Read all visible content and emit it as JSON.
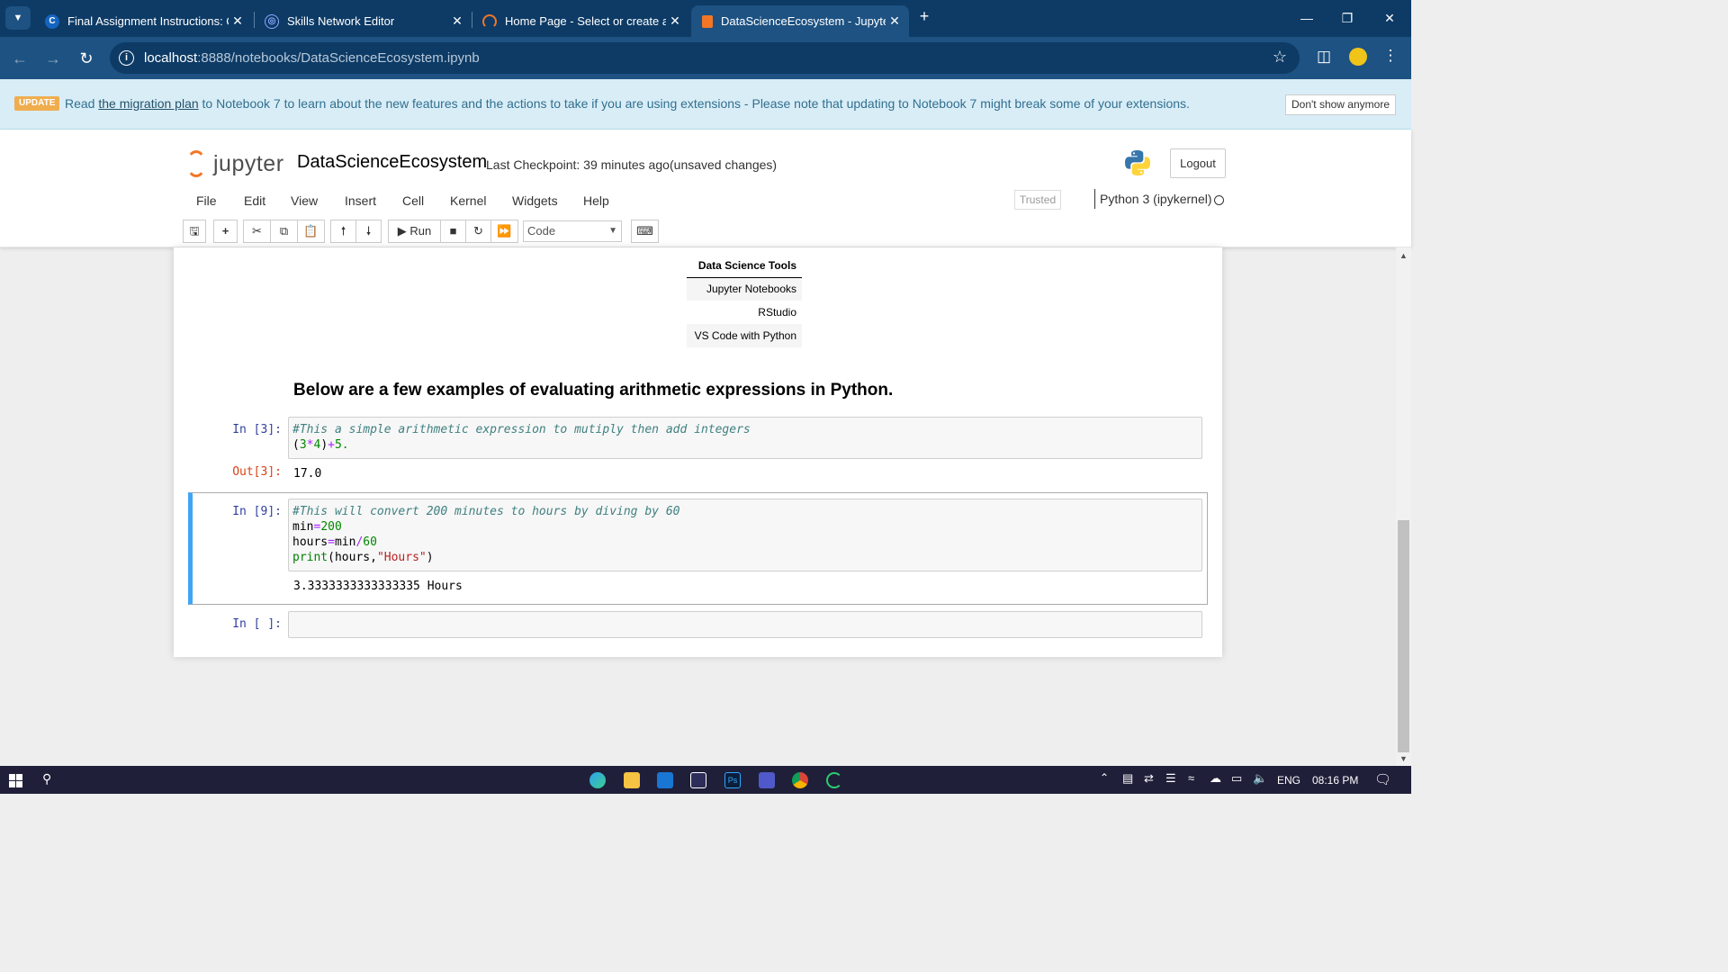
{
  "browser": {
    "tabs": [
      {
        "title": "Final Assignment Instructions: C",
        "active": false
      },
      {
        "title": "Skills Network Editor",
        "active": false
      },
      {
        "title": "Home Page - Select or create a",
        "active": false
      },
      {
        "title": "DataScienceEcosystem - Jupyte",
        "active": true
      }
    ],
    "url_host": "localhost",
    "url_rest": ":8888/notebooks/DataScienceEcosystem.ipynb"
  },
  "banner": {
    "badge": "UPDATE",
    "prefix": "Read",
    "link": "the migration plan",
    "message": "to Notebook 7 to learn about the new features and the actions to take if you are using extensions - Please note that updating to Notebook 7 might break some of your extensions.",
    "dismiss": "Don't show anymore"
  },
  "header": {
    "logo_text": "jupyter",
    "notebook_name": "DataScienceEcosystem",
    "checkpoint": "Last Checkpoint: 39 minutes ago",
    "status": "(unsaved changes)",
    "logout": "Logout"
  },
  "menu": {
    "items": [
      "File",
      "Edit",
      "View",
      "Insert",
      "Cell",
      "Kernel",
      "Widgets",
      "Help"
    ],
    "trusted": "Trusted",
    "kernel": "Python 3 (ipykernel)"
  },
  "toolbar": {
    "run": "Run",
    "cell_type": "Code"
  },
  "markdown": {
    "table_header": "Data Science Tools",
    "table_rows": [
      "Jupyter Notebooks",
      "RStudio",
      "VS Code with Python"
    ],
    "heading": "Below are a few examples of evaluating arithmetic expressions in Python."
  },
  "cells": [
    {
      "prompt": "In [3]:",
      "lines": [
        "#This a simple arithmetic expression to mutiply then add integers",
        "(3*4)+5."
      ],
      "out_prompt": "Out[3]:",
      "output": "17.0"
    },
    {
      "prompt": "In [9]:",
      "lines": [
        "#This will convert 200 minutes to hours by diving by 60",
        "min=200",
        "hours=min/60",
        "print(hours,\"Hours\")"
      ],
      "output": "3.3333333333333335 Hours"
    },
    {
      "prompt": "In [ ]:"
    }
  ],
  "taskbar": {
    "language": "ENG",
    "time": "08:16 PM"
  },
  "colors": {
    "chrome_dark": "#0d3b66",
    "chrome_mid": "#1d5282",
    "banner_bg": "#d9edf7",
    "selected_cell_accent": "#42a5f5",
    "jupyter_orange": "#f37626"
  }
}
